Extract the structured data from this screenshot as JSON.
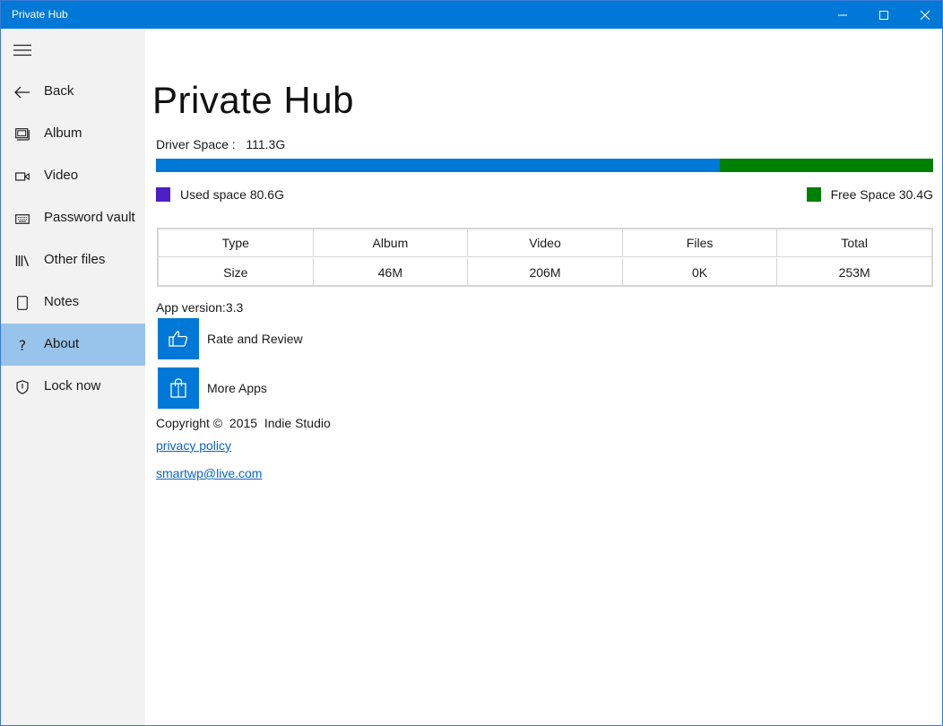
{
  "window": {
    "title": "Private Hub"
  },
  "sidebar": {
    "items": [
      {
        "label": "Back",
        "icon": "back-arrow-icon"
      },
      {
        "label": "Album",
        "icon": "album-icon"
      },
      {
        "label": "Video",
        "icon": "video-camera-icon"
      },
      {
        "label": "Password vault",
        "icon": "keyboard-icon"
      },
      {
        "label": "Other files",
        "icon": "library-icon"
      },
      {
        "label": "Notes",
        "icon": "note-icon"
      },
      {
        "label": "About",
        "icon": "question-icon",
        "active": true
      },
      {
        "label": "Lock now",
        "icon": "shield-icon"
      }
    ]
  },
  "main": {
    "title": "Private Hub",
    "drive_space": "Driver Space :   111.3G",
    "storage": {
      "used_fraction": 0.726,
      "used_label": "Used space 80.6G",
      "free_label": "Free Space 30.4G",
      "used_bar_color": "#0078d7",
      "free_bar_color": "#008000",
      "used_swatch_color": "#4b1fc4",
      "free_swatch_color": "#008000"
    },
    "table": {
      "headers": [
        "Type",
        "Album",
        "Video",
        "Files",
        "Total"
      ],
      "row": [
        "Size",
        "46M",
        "206M",
        "0K",
        "253M"
      ]
    },
    "app_version": "App version:3.3",
    "actions": {
      "rate": "Rate and Review",
      "more": "More Apps"
    },
    "copyright": "Copyright ©  2015  Indie Studio",
    "privacy_link": "privacy policy",
    "email_link": "smartwp@live.com"
  },
  "colors": {
    "accent": "#0078d7",
    "sidebar_bg": "#f2f2f2",
    "sidebar_active": "#98c3ea"
  }
}
